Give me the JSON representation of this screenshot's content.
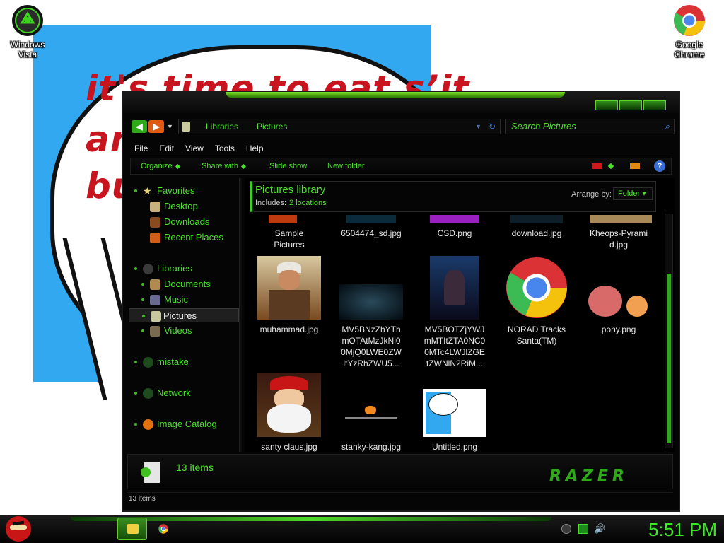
{
  "desktop": {
    "meme_lines": [
      "it's time to eat s’it",
      "an",
      "bu"
    ],
    "icons": [
      {
        "name": "Windows Vista",
        "line1": "Windows",
        "line2": "Vista"
      },
      {
        "name": "Google Chrome",
        "line1": "Google",
        "line2": "Chrome"
      }
    ]
  },
  "explorer": {
    "breadcrumb": [
      "Libraries",
      "Pictures"
    ],
    "search_placeholder": "Search Pictures",
    "menu": [
      "File",
      "Edit",
      "View",
      "Tools",
      "Help"
    ],
    "commands": [
      "Organize",
      "Share with",
      "Slide show",
      "New folder"
    ],
    "nav": {
      "favorites": "Favorites",
      "desktop": "Desktop",
      "downloads": "Downloads",
      "recent": "Recent Places",
      "libraries": "Libraries",
      "documents": "Documents",
      "music": "Music",
      "pictures": "Pictures",
      "videos": "Videos",
      "mistake": "mistake",
      "network": "Network",
      "image_catalog": "Image Catalog"
    },
    "library": {
      "title": "Pictures library",
      "includes_label": "Includes:",
      "includes_value": "2 locations",
      "arrange_label": "Arrange by:",
      "arrange_value": "Folder"
    },
    "files_row1": [
      {
        "l1": "Sample",
        "l2": "Pictures",
        "l3": ""
      },
      {
        "l1": "6504474_sd.jpg",
        "l2": "",
        "l3": ""
      },
      {
        "l1": "CSD.png",
        "l2": "",
        "l3": ""
      },
      {
        "l1": "download.jpg",
        "l2": "",
        "l3": ""
      },
      {
        "l1": "Kheops-Pyrami",
        "l2": "d.jpg",
        "l3": ""
      }
    ],
    "files_row2": [
      {
        "l1": "muhammad.jpg",
        "l2": "",
        "l3": ""
      },
      {
        "l1": "MV5BNzZhYTh",
        "l2": "mOTAtMzJkNi0",
        "l3": "0MjQ0LWE0ZW",
        "l4": "ltYzRhZWU5..."
      },
      {
        "l1": "MV5BOTZjYWJ",
        "l2": "mMTItZTA0NC0",
        "l3": "0MTc4LWJlZGE",
        "l4": "tZWNlN2RiM..."
      },
      {
        "l1": "NORAD Tracks",
        "l2": "Santa(TM)",
        "l3": ""
      },
      {
        "l1": "pony.png",
        "l2": "",
        "l3": ""
      }
    ],
    "files_row3": [
      {
        "l1": "santy claus.jpg"
      },
      {
        "l1": "stanky-kang.jpg"
      },
      {
        "l1": "Untitled.png"
      }
    ],
    "details_count": "13 items",
    "status_count": "13 items",
    "brand": "RAZER"
  },
  "taskbar": {
    "clock": "5:51 PM"
  },
  "colors": {
    "accent": "#4be02b",
    "window_bg": "#050505",
    "wallpaper_blue": "#31a8f0",
    "meme_red": "#c8141e"
  }
}
